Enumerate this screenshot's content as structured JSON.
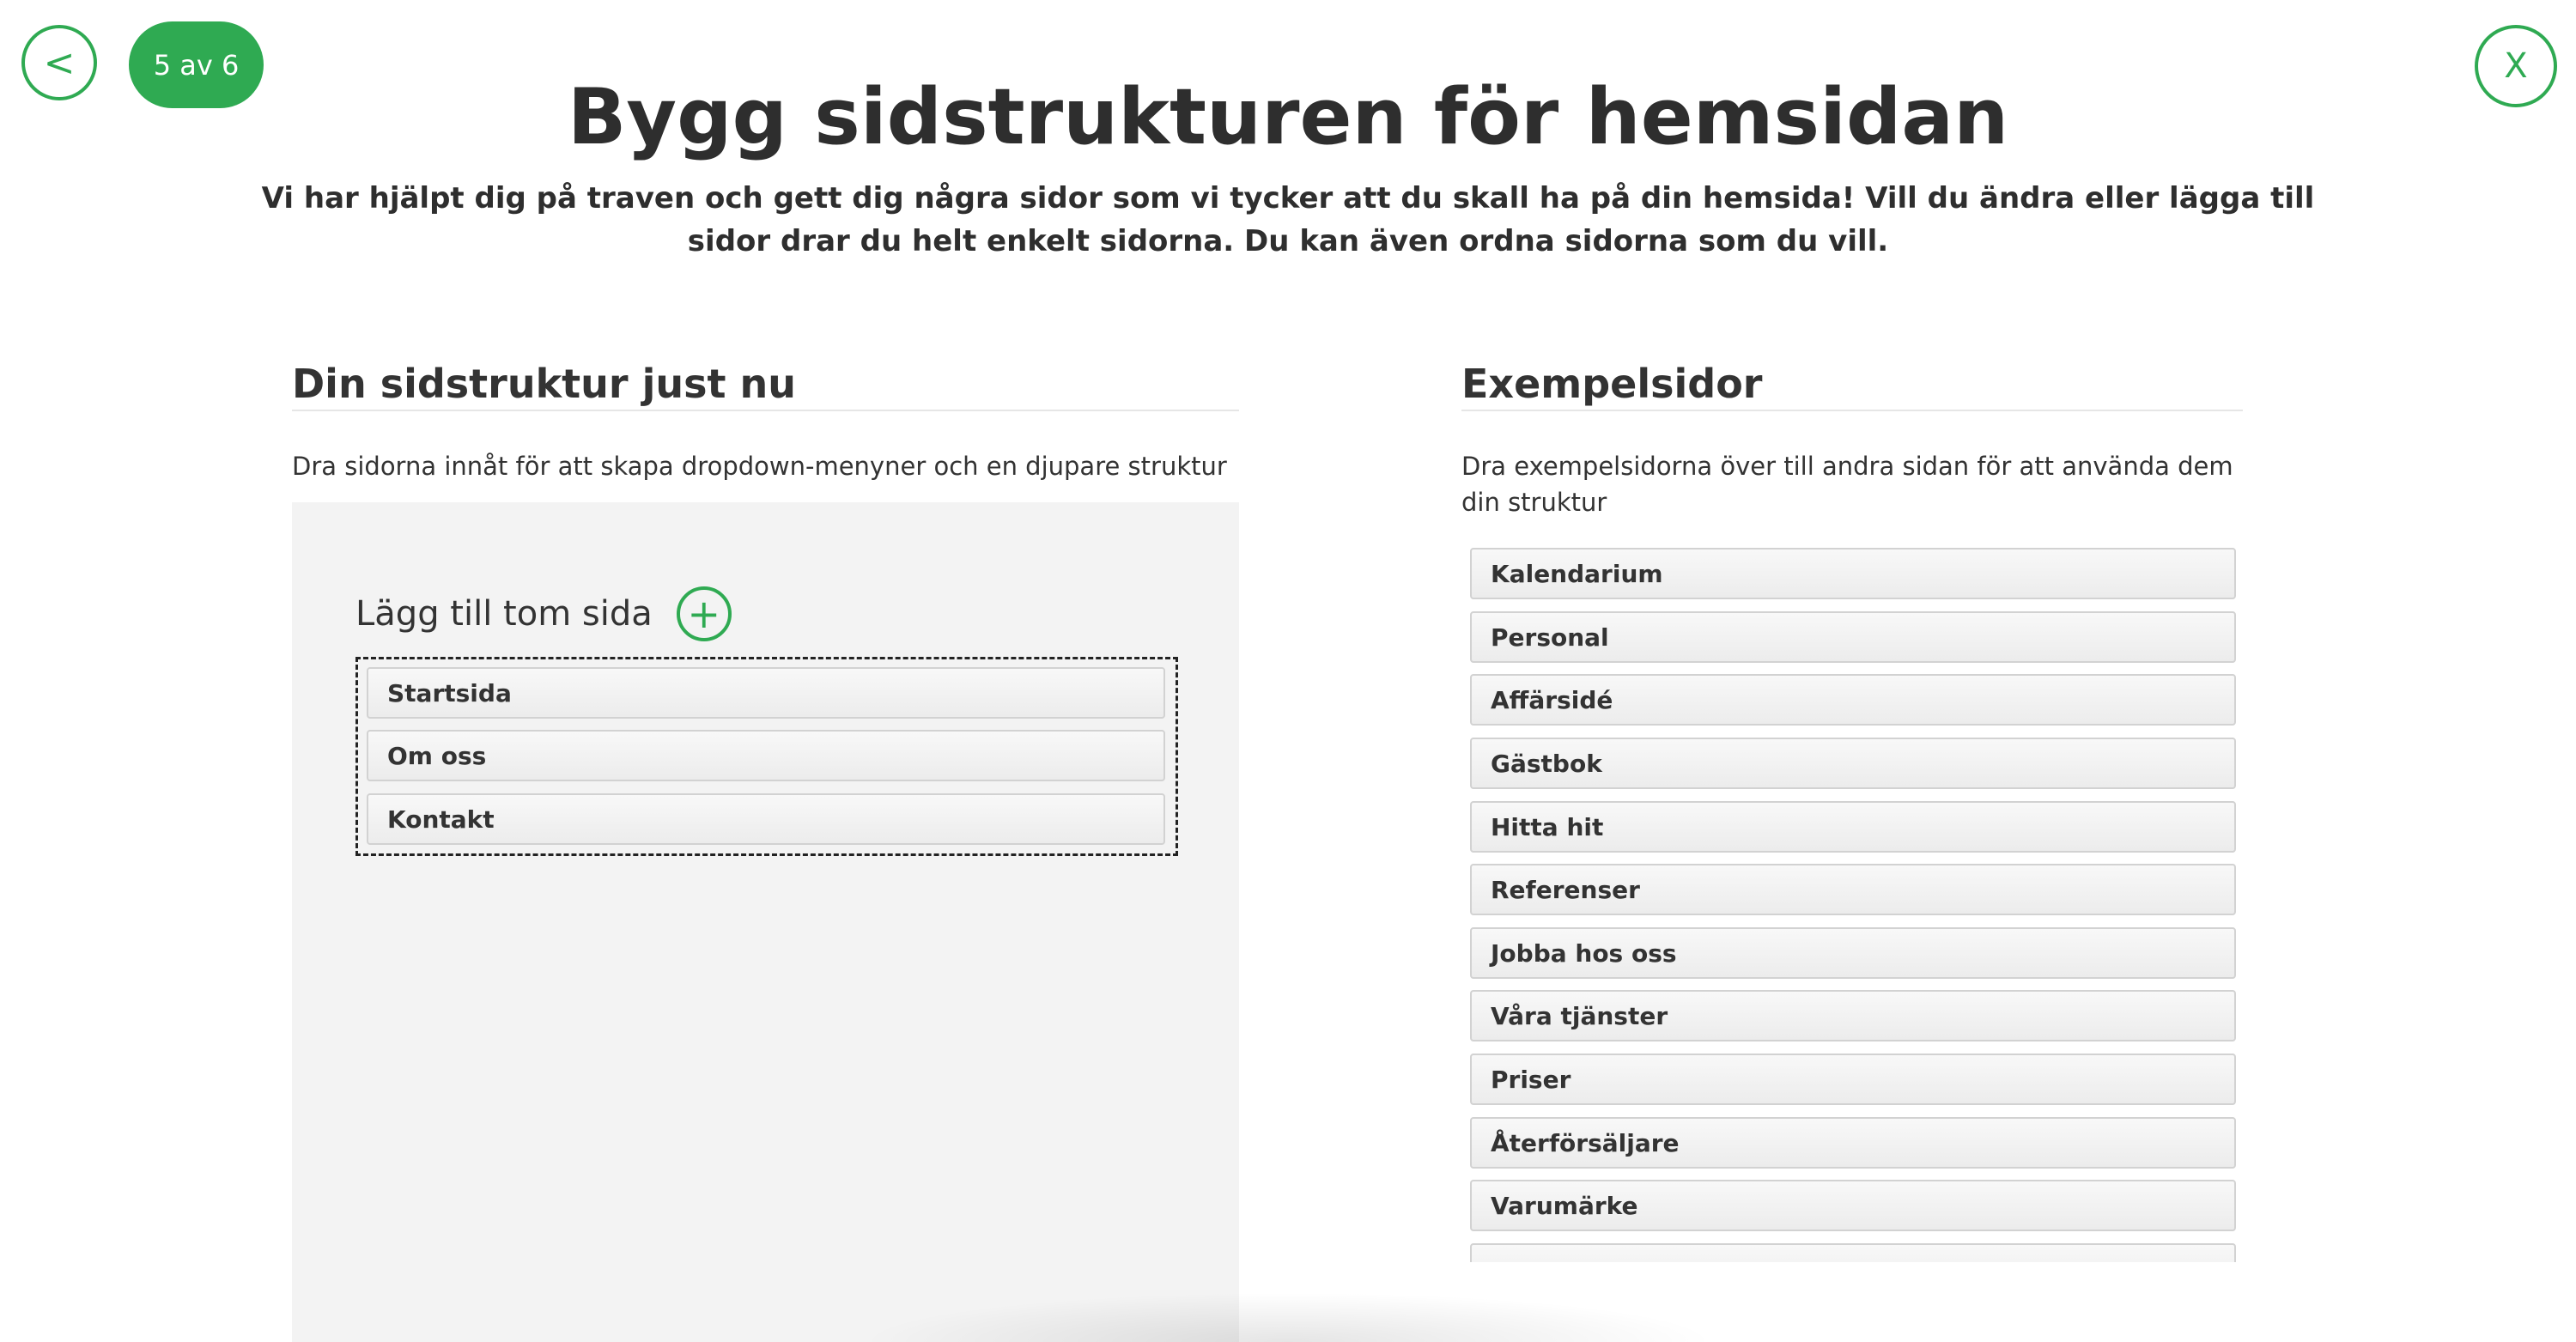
{
  "nav": {
    "back_label": "<",
    "step_label": "5 av 6",
    "close_label": "X"
  },
  "header": {
    "title": "Bygg sidstrukturen för hemsidan",
    "subtitle": "Vi har hjälpt dig på traven och gett dig några sidor som vi tycker att du skall ha på din hemsida! Vill du ändra eller lägga till sidor drar du helt enkelt sidorna. Du kan även ordna sidorna som du vill."
  },
  "structure": {
    "title": "Din sidstruktur just nu",
    "description": "Dra sidorna innåt för att skapa dropdown-menyner och en djupare struktur",
    "add_page_label": "Lägg till tom sida",
    "add_icon": "plus-circle-icon",
    "pages": [
      "Startsida",
      "Om oss",
      "Kontakt"
    ]
  },
  "examples": {
    "title": "Exempelsidor",
    "description": "Dra exempelsidorna över till andra sidan för att använda dem din struktur",
    "pages": [
      "Kalendarium",
      "Personal",
      "Affärsidé",
      "Gästbok",
      "Hitta hit",
      "Referenser",
      "Jobba hos oss",
      "Våra tjänster",
      "Priser",
      "Återförsäljare",
      "Varumärke",
      ""
    ]
  },
  "colors": {
    "accent": "#2faa52",
    "panel_bg": "#f3f3f3",
    "text": "#333333"
  }
}
